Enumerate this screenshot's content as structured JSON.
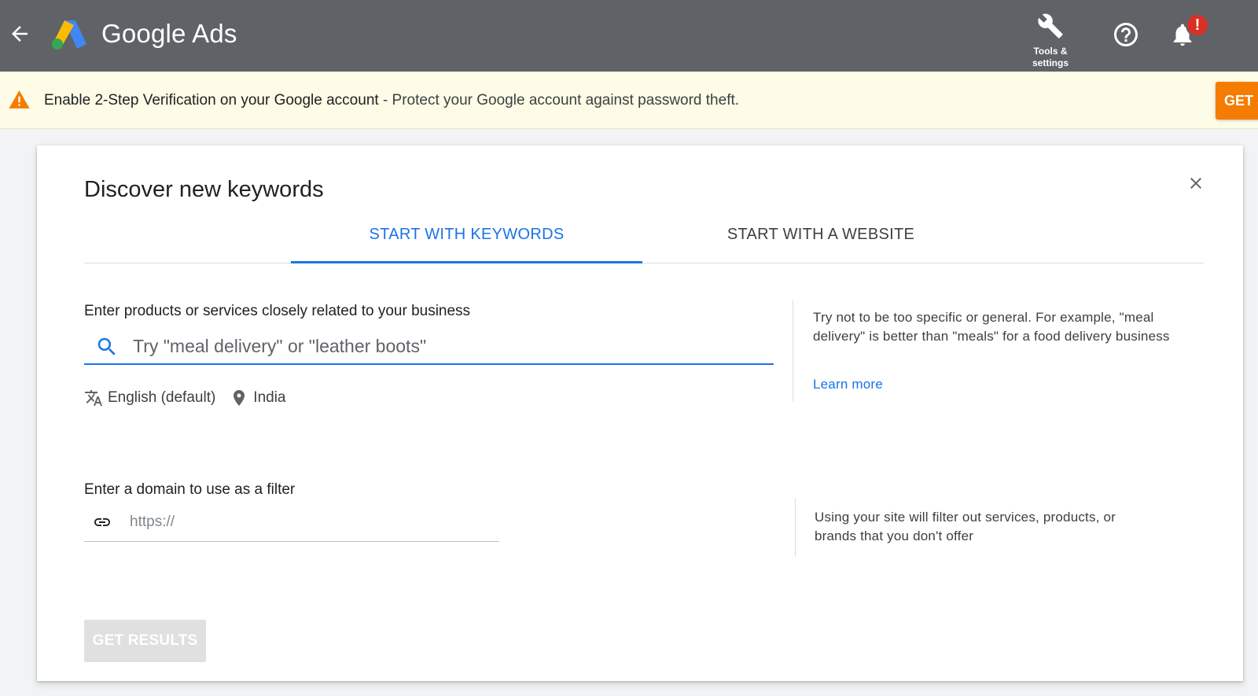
{
  "header": {
    "brand": "Google Ads",
    "tools_label": "Tools &\nsettings",
    "notification_badge": "!",
    "icons": [
      "arrow-back-icon",
      "google-ads-logo",
      "wrench-icon",
      "help-icon",
      "bell-icon"
    ]
  },
  "banner": {
    "title": "Enable 2-Step Verification on your Google account",
    "message": " - Protect your Google account against password theft.",
    "button_label": "GET S"
  },
  "dialog": {
    "title": "Discover new keywords",
    "tabs": [
      {
        "label": "START WITH KEYWORDS",
        "active": true
      },
      {
        "label": "START WITH A WEBSITE",
        "active": false
      }
    ],
    "keywords": {
      "label": "Enter products or services closely related to your business",
      "placeholder": "Try \"meal delivery\" or \"leather boots\"",
      "value": "",
      "language": "English (default)",
      "location": "India",
      "tip": "Try not to be too specific or general. For example, \"meal delivery\" is better than \"meals\" for a food delivery business",
      "learn_more": "Learn more"
    },
    "domain": {
      "label": "Enter a domain to use as a filter",
      "placeholder": "https://",
      "value": "",
      "tip": "Using your site will filter out services, products, or brands that you don't offer"
    },
    "submit_label": "GET RESULTS"
  },
  "colors": {
    "header_bg": "#5f6368",
    "banner_bg": "#fefbe6",
    "accent": "#1a73e8",
    "warning": "#f57c00",
    "badge": "#d93025"
  }
}
